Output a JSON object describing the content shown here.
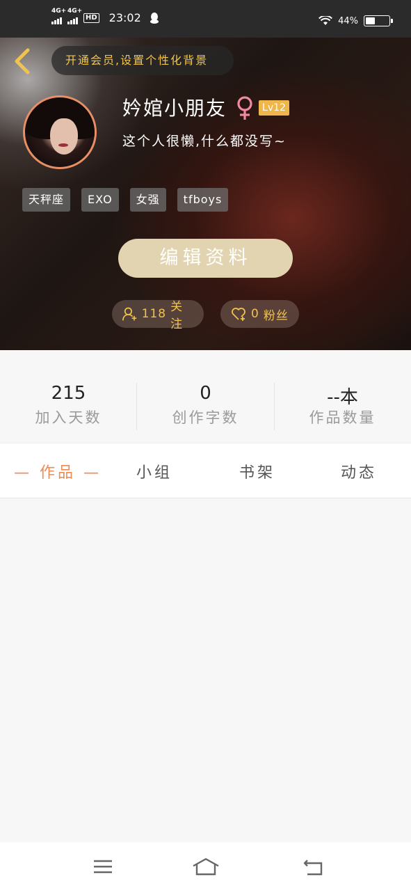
{
  "status_bar": {
    "signal1": "4G+",
    "signal2": "4G+",
    "hd": "HD",
    "time": "23:02",
    "battery": "44%",
    "battery_level": 0.44
  },
  "header": {
    "vip_banner": "开通会员,设置个性化背景",
    "username": "妗婠小朋友",
    "gender_icon": "female-icon",
    "level": "Lv12",
    "bio": "这个人很懒,什么都没写~",
    "tags": [
      "天秤座",
      "EXO",
      "女强",
      "tfboys"
    ],
    "edit_button": "编辑资料",
    "following_count": "118",
    "following_label": "关注",
    "followers_count": "0",
    "followers_label": "粉丝",
    "accent_color": "#f0c24f"
  },
  "stats": [
    {
      "value": "215",
      "label": "加入天数"
    },
    {
      "value": "0",
      "label": "创作字数"
    },
    {
      "value": "--本",
      "label": "作品数量"
    }
  ],
  "tabs": [
    {
      "label": "— 作品 —",
      "active": true
    },
    {
      "label": "小组",
      "active": false
    },
    {
      "label": "书架",
      "active": false
    },
    {
      "label": "动态",
      "active": false
    }
  ],
  "nav": [
    "menu-icon",
    "home-icon",
    "back-icon"
  ]
}
